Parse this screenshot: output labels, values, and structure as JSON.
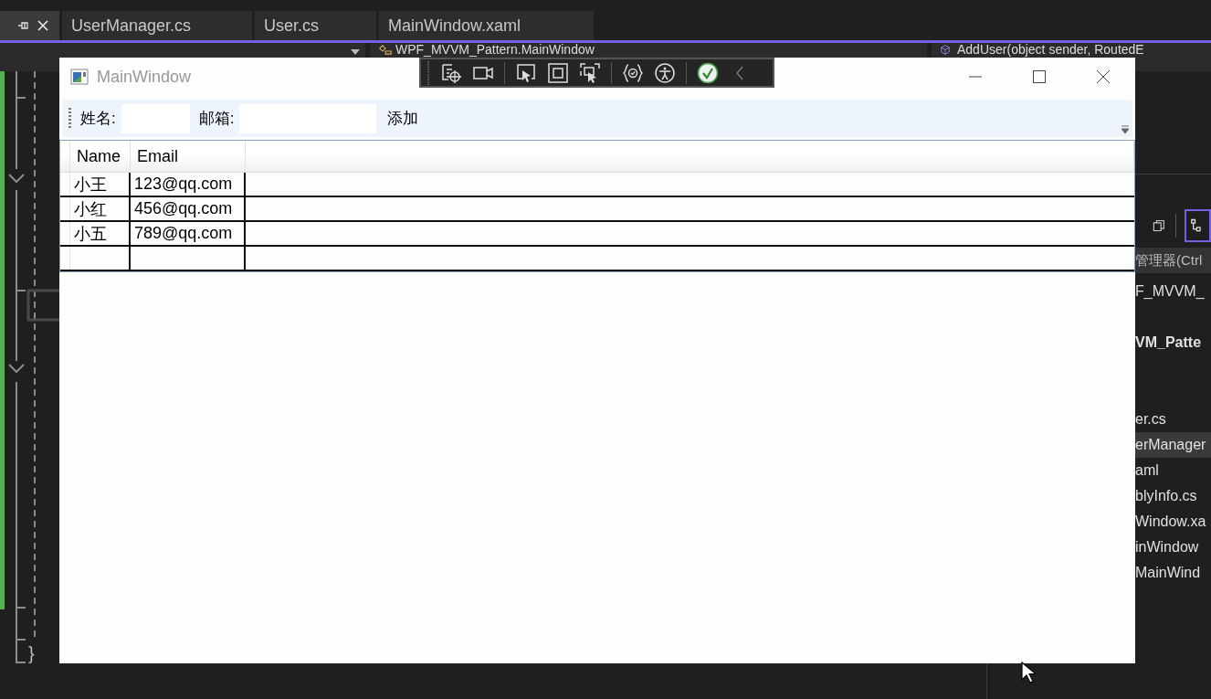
{
  "ide": {
    "tabs": [
      {
        "selected": true
      },
      {
        "label": "UserManager.cs",
        "selected": false
      },
      {
        "label": "User.cs",
        "selected": false
      },
      {
        "label": "MainWindow.xaml",
        "selected": false
      }
    ],
    "nav_bar": {
      "type_combo": "WPF_MVVM_Pattern.MainWindow",
      "member_combo": "AddUser(object sender, RoutedE"
    },
    "code": {
      "closing_brace": "}"
    },
    "solution_explorer": {
      "search_placeholder": "管理器(Ctrl",
      "solution": "F_MVVM_",
      "project": "VM_Patte",
      "files": [
        {
          "label": "er.cs",
          "selected": false
        },
        {
          "label": "erManager",
          "selected": true
        },
        {
          "label": "aml",
          "selected": false
        },
        {
          "label": "blyInfo.cs",
          "selected": false
        },
        {
          "label": "Window.xa",
          "selected": false
        },
        {
          "label": "inWindow",
          "selected": false
        },
        {
          "label": "MainWind",
          "selected": false
        }
      ]
    }
  },
  "wpf_window": {
    "title": "MainWindow",
    "toolbar": {
      "name_label": "姓名:",
      "email_label": "邮箱:",
      "add_button": "添加"
    },
    "grid": {
      "columns": [
        "Name",
        "Email"
      ],
      "rows": [
        {
          "name": "小王",
          "email": "123@qq.com"
        },
        {
          "name": "小红",
          "email": "456@qq.com"
        },
        {
          "name": "小五",
          "email": "789@qq.com"
        }
      ]
    }
  }
}
